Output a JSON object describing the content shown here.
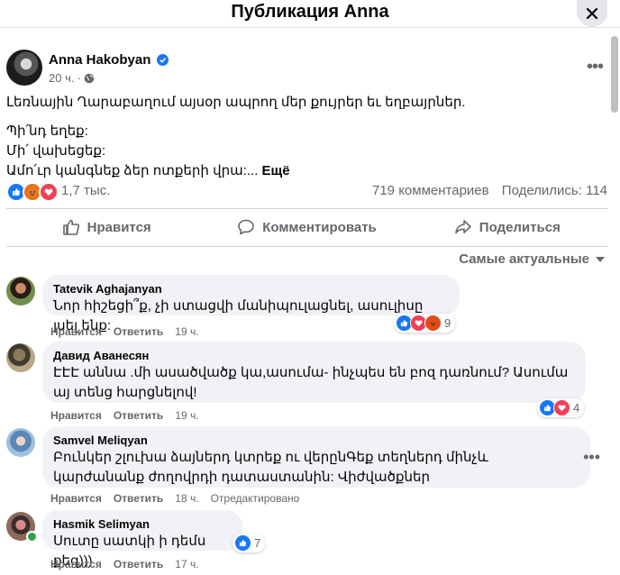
{
  "dialog": {
    "title": "Публикация Anna"
  },
  "post": {
    "author": "Anna Hakobyan",
    "time": "20 ч.",
    "lines": [
      "Լեռնային Ղարաբաղում այսօր ապրող մեր քույրեր եւ եղբայրներ.",
      "Պի՛նդ եղեք:",
      "Մի՛ վախեցեք:",
      "Ամո՛ւր կանգնեք ձեր ոտքերի վրա:..."
    ],
    "see_more": "Ещё",
    "reactions_count": "1,7 тыс.",
    "comments_count": "719 комментариев",
    "shares_count": "Поделились: 114"
  },
  "actions": {
    "like": "Нравится",
    "comment": "Комментировать",
    "share": "Поделиться"
  },
  "sort_label": "Самые актуальные",
  "comment_actions": {
    "like": "Нравится",
    "reply": "Ответить"
  },
  "comments": [
    {
      "name": "Tatevik Aghajanyan",
      "text": "Նոր հիշեցի՞ք, չի ստացվի մանիպուլացնել, ասուլիսը լսել ենք:",
      "time": "19 ч.",
      "reactions": "9"
    },
    {
      "name": "Давид Аванесян",
      "text": "ԷԷԷ աննա .մի ասածվածք կա,ասումա- ինչպես են բոզ դառնում? Ասումա այ տենց հարցնելով!",
      "time": "19 ч.",
      "reactions": "4"
    },
    {
      "name": "Samvel Meliqyan",
      "text": "Բունկեր շլուխա ձայներդ կտրեք ու վերընԳեք տեղներդ մինչև կարժանանք ժողովրդի դատաստանին: Վիժվածքներ",
      "time": "18 ч.",
      "edited": "Отредактировано",
      "reactions": ""
    },
    {
      "name": "Hasmik Selimyan",
      "text": "Սուտը սատկի ի դեմս քեզ)))",
      "time": "17 ч.",
      "reactions": "7"
    }
  ],
  "colors": {
    "like_blue": "#1877f2",
    "love_red": "#f33e58",
    "angry_orange": "#e9710f",
    "bubble_gray": "#f0f2f5",
    "online_green": "#31a24c"
  }
}
